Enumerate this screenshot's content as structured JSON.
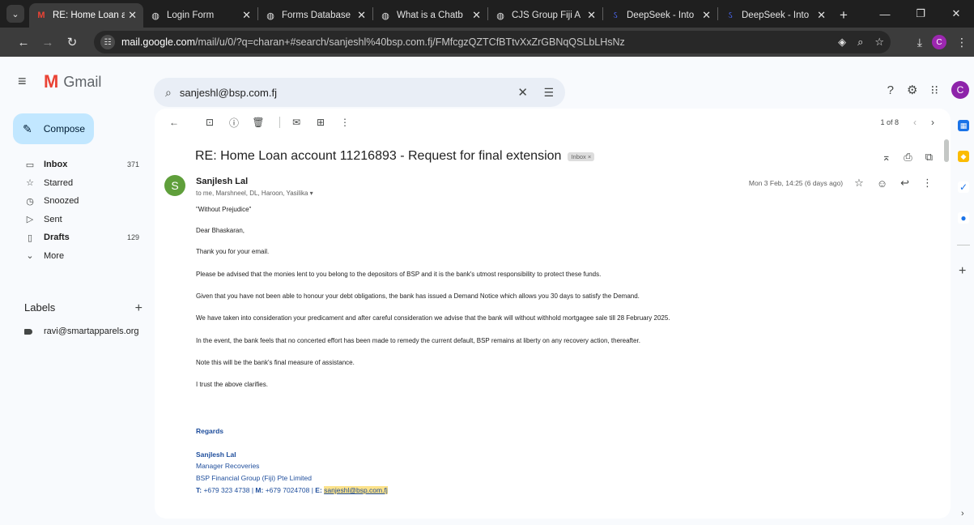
{
  "browser": {
    "tabs": [
      {
        "label": "RE: Home Loan a",
        "favicon": "gmail-icon",
        "active": true
      },
      {
        "label": "Login Form",
        "favicon": "globe-icon",
        "active": false
      },
      {
        "label": "Forms Database",
        "favicon": "globe-icon",
        "active": false
      },
      {
        "label": "What is a Chatb",
        "favicon": "globe-icon",
        "active": false
      },
      {
        "label": "CJS Group Fiji A",
        "favicon": "globe-icon",
        "active": false
      },
      {
        "label": "DeepSeek - Into",
        "favicon": "deepseek-icon",
        "active": false
      },
      {
        "label": "DeepSeek - Into",
        "favicon": "deepseek-icon",
        "active": false
      }
    ],
    "url_host": "mail.google.com",
    "url_path": "/mail/u/0/?q=charan+#search/sanjeshl%40bsp.com.fj/FMfcgzQZTCfBTtvXxZrGBNqQSLbLHsNz",
    "profile_initial": "C"
  },
  "gmail": {
    "logo_text": "Gmail",
    "search_value": "sanjeshl@bsp.com.fj",
    "avatar_initial": "C",
    "compose_label": "Compose",
    "nav": [
      {
        "label": "Inbox",
        "count": "371",
        "bold": true,
        "icon": "inbox-icon"
      },
      {
        "label": "Starred",
        "count": "",
        "bold": false,
        "icon": "star-icon"
      },
      {
        "label": "Snoozed",
        "count": "",
        "bold": false,
        "icon": "clock-icon"
      },
      {
        "label": "Sent",
        "count": "",
        "bold": false,
        "icon": "send-icon"
      },
      {
        "label": "Drafts",
        "count": "129",
        "bold": true,
        "icon": "draft-icon"
      },
      {
        "label": "More",
        "count": "",
        "bold": false,
        "icon": "chevron-down-icon"
      }
    ],
    "labels_heading": "Labels",
    "labels": [
      {
        "label": "ravi@smartapparels.org"
      }
    ],
    "pager_text": "1 of 8"
  },
  "message": {
    "subject": "RE: Home Loan account 11216893 - Request for final extension",
    "chip": "Inbox",
    "sender_initial": "S",
    "sender_name": "Sanjlesh Lal",
    "recipients": "to me, Marshneel, DL, Haroon, Yasilika",
    "date": "Mon 3 Feb, 14:25 (6 days ago)",
    "paragraphs": [
      "\"Without Prejudice\"",
      "Dear Bhaskaran,",
      "Thank you for your email.",
      "Please be advised that the monies lent to you belong to the depositors of BSP and it is the bank's utmost responsibility to protect these funds.",
      "Given that you have not been able to honour your debt obligations, the bank has issued a Demand Notice which allows you 30 days to satisfy the Demand.",
      "We have taken into consideration your predicament and after careful consideration we advise that the bank will without withhold mortgagee sale till 28 February 2025.",
      "In the event, the bank feels that no concerted effort has been made to remedy the current default, BSP remains at liberty on any recovery action, thereafter.",
      "Note this will be the bank's final measure of assistance.",
      "I trust the above clarifies."
    ],
    "signature": {
      "regards": "Regards",
      "name": "Sanjlesh Lal",
      "title": "Manager Recoveries",
      "company": "BSP Financial Group (Fiji) Pte Limited",
      "t_label": "T:",
      "t_value": "+679 323 4738",
      "sep": "|",
      "m_label": "M:",
      "m_value": "+679 7024708",
      "e_label": "E:",
      "e_value": "sanjeshl@bsp.com.fj"
    }
  }
}
